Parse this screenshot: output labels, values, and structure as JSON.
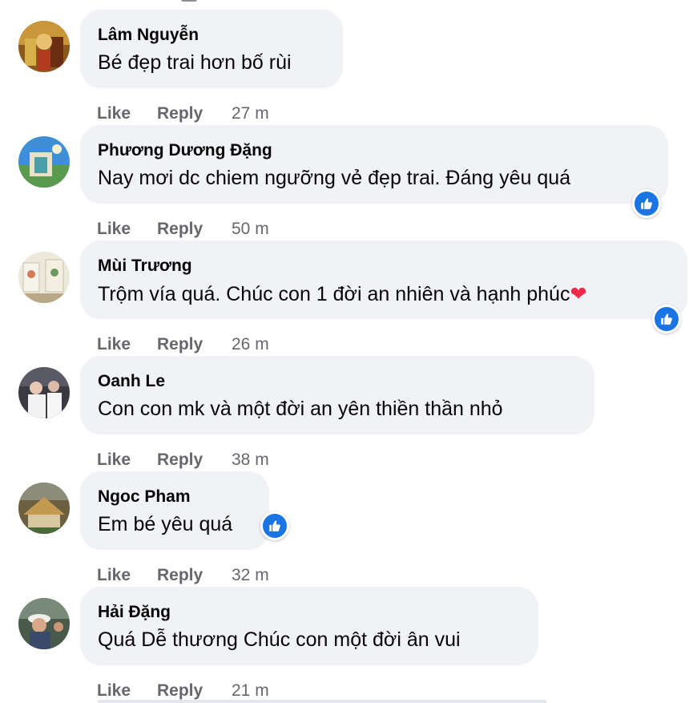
{
  "actions": {
    "like": "Like",
    "reply": "Reply"
  },
  "comments": [
    {
      "author": "Lâm Nguyễn",
      "text": "Bé đẹp trai hơn bố rùi",
      "time": "27 m"
    },
    {
      "author": "Phương Dương Đặng",
      "text": "Nay mơi dc chiem ngưỡng vẻ đẹp trai. Đáng yêu quá",
      "time": "50 m"
    },
    {
      "author": "Mùi Trương",
      "text": "Trộm vía quá. Chúc con 1 đời an nhiên và hạnh phúc",
      "emoji": "❤",
      "time": "26 m"
    },
    {
      "author": "Oanh Le",
      "text": "Con con mk và một đời an yên thiền thần nhỏ",
      "time": "38 m"
    },
    {
      "author": "Ngoc Pham",
      "text": "Em bé yêu quá",
      "time": "32 m"
    },
    {
      "author": "Hải Đặng",
      "text": "Quá Dễ thương Chúc con một đời ân vui",
      "time": "21 m"
    }
  ],
  "colors": {
    "bubble": "#f0f2f5",
    "meta_text": "#65676b",
    "like_blue": "#1b74e4",
    "heart_red": "#f02849"
  },
  "icons": {
    "reaction": "like-thumbs-up-icon",
    "emoji": "red-heart-icon"
  }
}
